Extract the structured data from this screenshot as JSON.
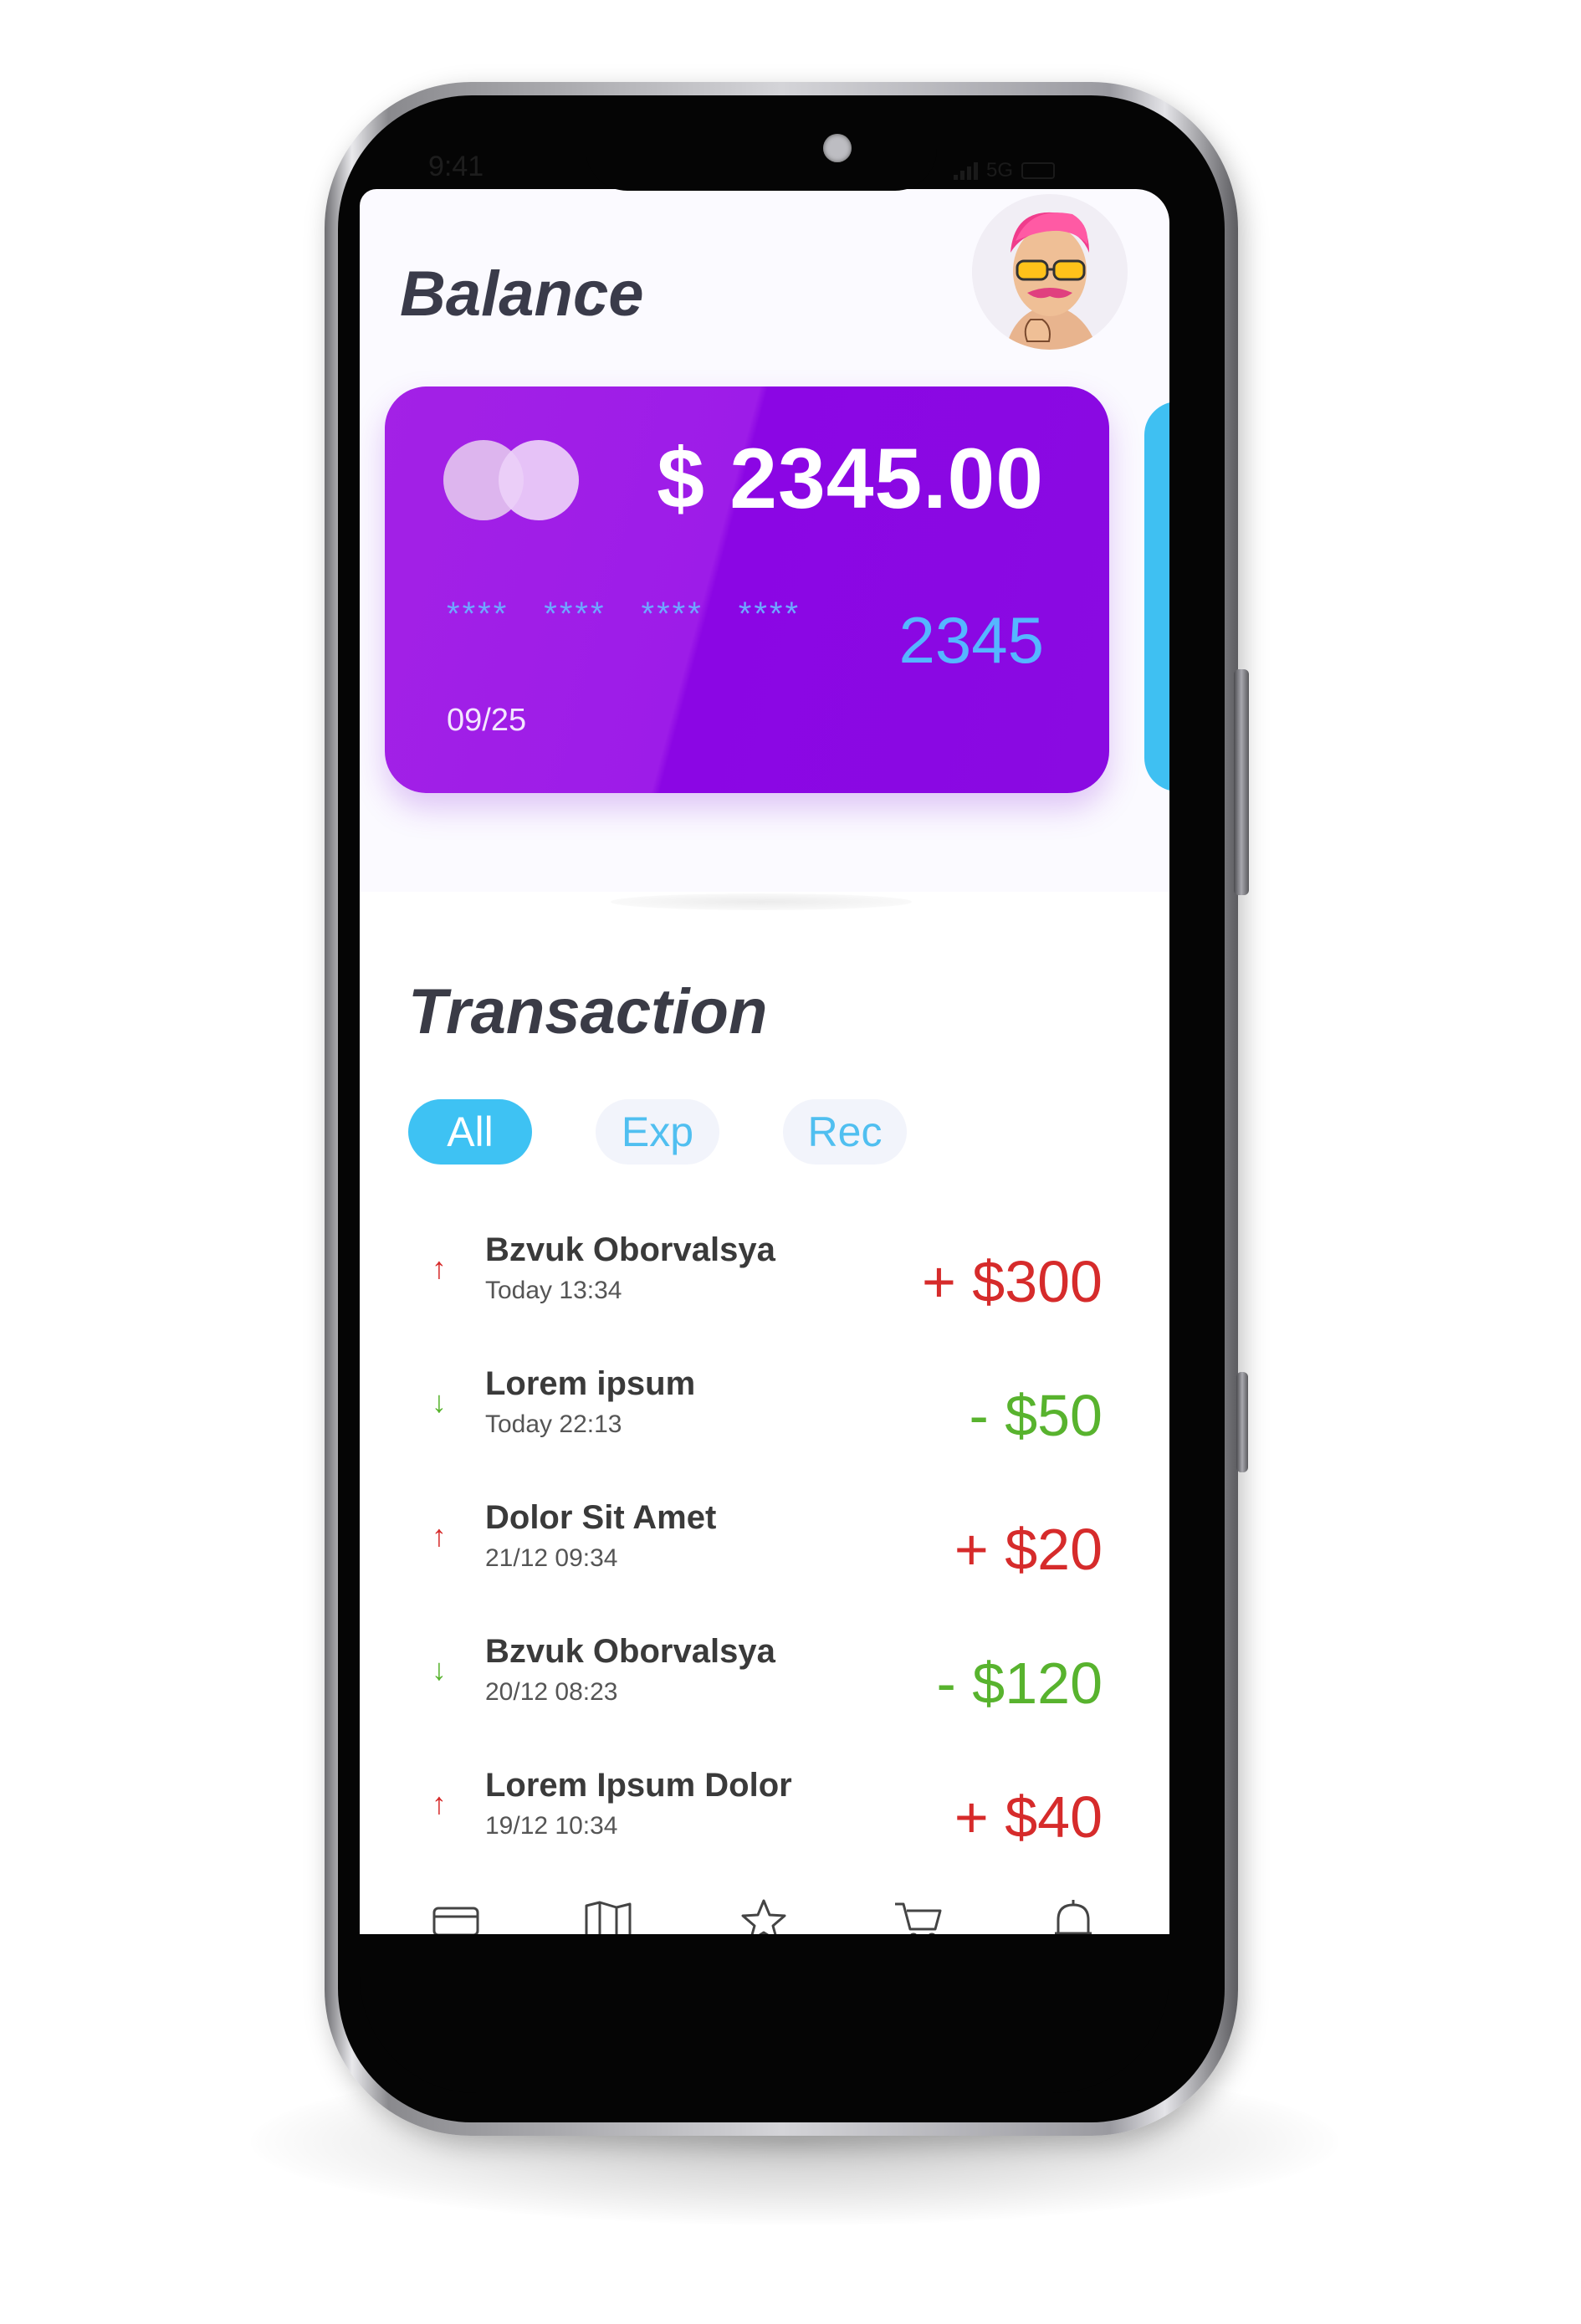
{
  "status_bar": {
    "time": "9:41",
    "network": "5G"
  },
  "header": {
    "title": "Balance",
    "avatar_icon": "avatar-man-pink-hair-sunglasses"
  },
  "card": {
    "balance": "$ 2345.00",
    "masked_groups": [
      "****",
      "****",
      "****",
      "****"
    ],
    "last4": "2345",
    "expiry": "09/25",
    "color": "#9b16e8",
    "next_card_color": "#3fc0f2"
  },
  "transactions": {
    "title": "Transaction",
    "tabs": [
      {
        "label": "All",
        "active": true
      },
      {
        "label": "Exp",
        "active": false
      },
      {
        "label": "Rec",
        "active": false
      }
    ],
    "items": [
      {
        "name": "Bzvuk Oborvalsya",
        "date": "Today 13:34",
        "amount": "+ $300",
        "direction": "up",
        "arrow": "↑",
        "color": "#d62b2b"
      },
      {
        "name": "Lorem ipsum",
        "date": "Today 22:13",
        "amount": "- $50",
        "direction": "down",
        "arrow": "↓",
        "color": "#58b32e"
      },
      {
        "name": "Dolor Sit Amet",
        "date": "21/12 09:34",
        "amount": "+ $20",
        "direction": "up",
        "arrow": "↑",
        "color": "#d62b2b"
      },
      {
        "name": "Bzvuk Oborvalsya",
        "date": "20/12 08:23",
        "amount": "- $120",
        "direction": "down",
        "arrow": "↓",
        "color": "#58b32e"
      },
      {
        "name": "Lorem Ipsum Dolor",
        "date": "19/12 10:34",
        "amount": "+ $40",
        "direction": "up",
        "arrow": "↑",
        "color": "#d62b2b"
      }
    ]
  },
  "bottom_nav": {
    "items": [
      "card-icon",
      "map-icon",
      "star-icon",
      "cart-icon",
      "bell-icon"
    ]
  }
}
